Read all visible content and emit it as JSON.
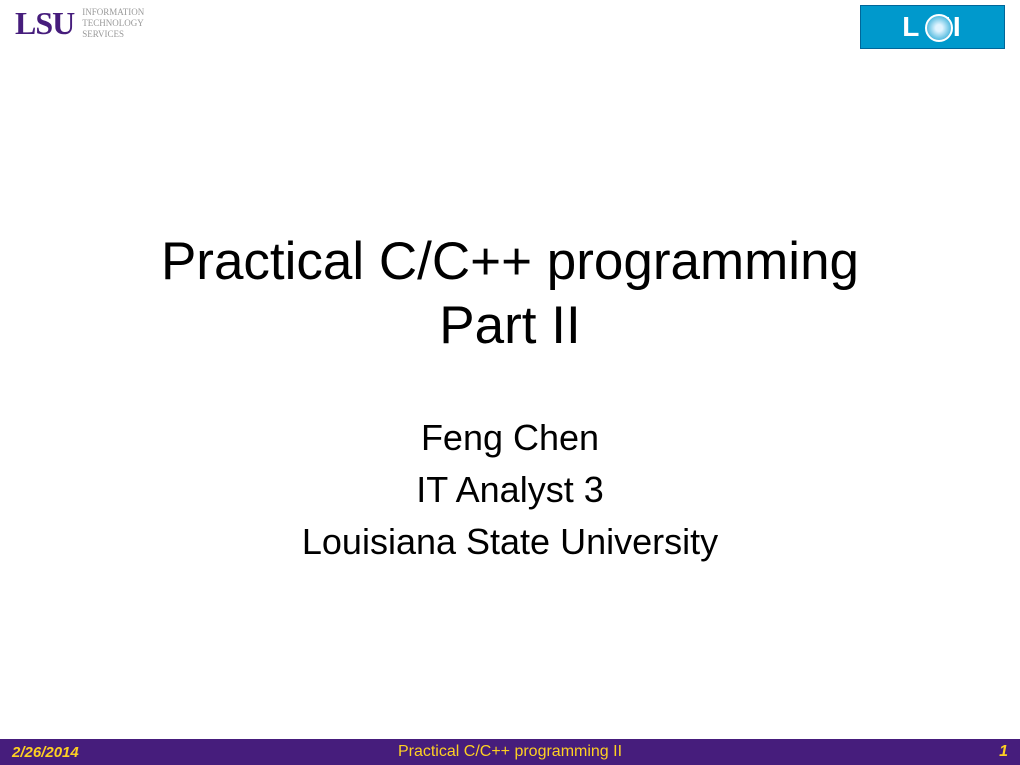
{
  "header": {
    "lsu_logo_text": "LSU",
    "lsu_subtitle_line1": "INFORMATION",
    "lsu_subtitle_line2": "TECHNOLOGY",
    "lsu_subtitle_line3": "SERVICES",
    "loni_text": "L  NI"
  },
  "content": {
    "title_line1": "Practical C/C++ programming",
    "title_line2": "Part II",
    "author_name": "Feng Chen",
    "author_role": "IT Analyst 3",
    "author_org": "Louisiana State University"
  },
  "footer": {
    "date": "2/26/2014",
    "title": "Practical C/C++ programming II",
    "page": "1"
  }
}
